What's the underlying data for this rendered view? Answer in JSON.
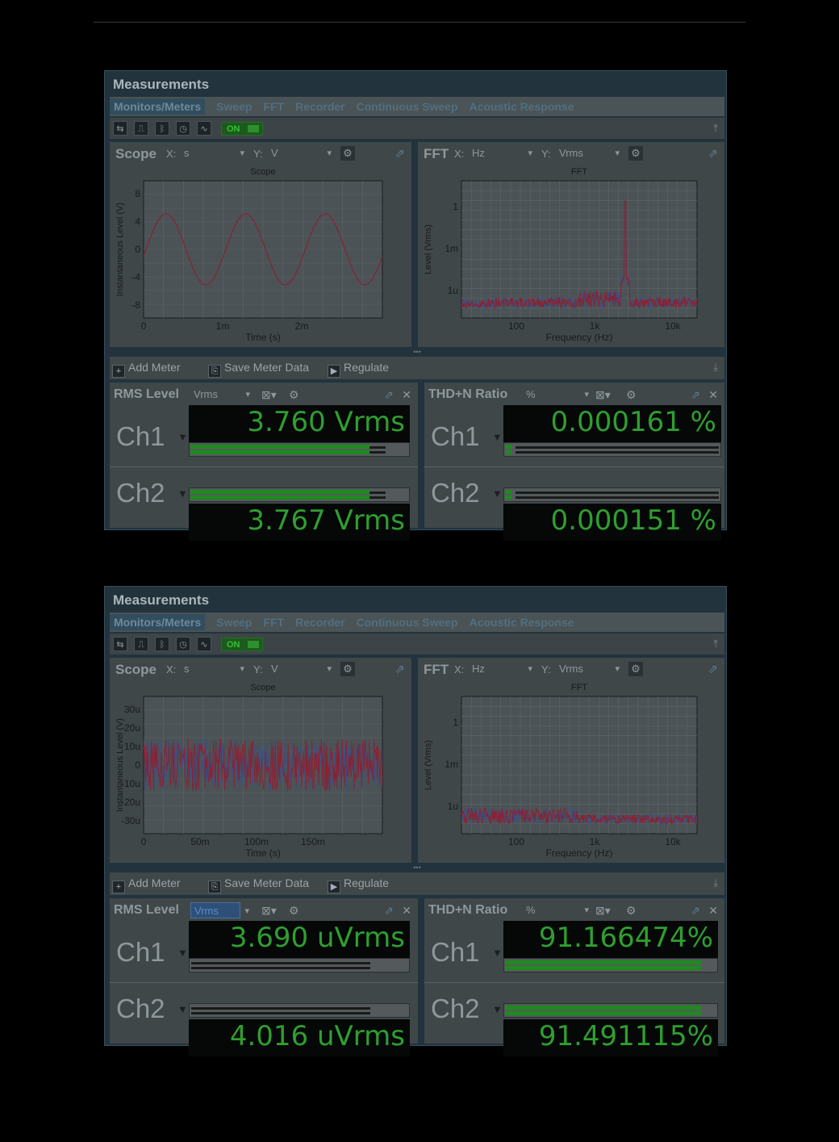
{
  "windows": [
    {
      "title": "Measurements",
      "tabs": [
        "Monitors/Meters",
        "Sweep",
        "FFT",
        "Recorder",
        "Continuous Sweep",
        "Acoustic Response"
      ],
      "on_label": "ON",
      "scope": {
        "title": "Scope",
        "x_label": "X:",
        "x_unit": "s",
        "y_label": "Y:",
        "y_unit": "V",
        "plot_title": "Scope",
        "ylabel": "Instantaneous Level (V)",
        "xlabel": "Time (s)",
        "yticks": [
          "8",
          "4",
          "0",
          "-4",
          "-8"
        ],
        "xticks": [
          "0",
          "1m",
          "2m"
        ]
      },
      "fft": {
        "title": "FFT",
        "x_label": "X:",
        "x_unit": "Hz",
        "y_label": "Y:",
        "y_unit": "Vrms",
        "plot_title": "FFT",
        "ylabel": "Level (Vrms)",
        "xlabel": "Frequency (Hz)",
        "yticks": [
          "1",
          "1m",
          "1u"
        ],
        "xticks": [
          "100",
          "1k",
          "10k"
        ]
      },
      "meterbar": {
        "add": "Add Meter",
        "save": "Save Meter Data",
        "regulate": "Regulate"
      },
      "rms": {
        "title": "RMS Level",
        "unit": "Vrms",
        "ch1_label": "Ch1",
        "ch2_label": "Ch2",
        "ch1_value": "3.760  Vrms",
        "ch2_value": "3.767  Vrms",
        "ch1_level": 0.89,
        "ch2_level": 0.89
      },
      "thd": {
        "title": "THD+N Ratio",
        "unit": "%",
        "ch1_label": "Ch1",
        "ch2_label": "Ch2",
        "ch1_value": "0.000161 %",
        "ch2_value": "0.000151 %",
        "ch1_level": 0.03,
        "ch2_level": 0.03
      }
    },
    {
      "title": "Measurements",
      "tabs": [
        "Monitors/Meters",
        "Sweep",
        "FFT",
        "Recorder",
        "Continuous Sweep",
        "Acoustic Response"
      ],
      "on_label": "ON",
      "scope": {
        "title": "Scope",
        "x_label": "X:",
        "x_unit": "s",
        "y_label": "Y:",
        "y_unit": "V",
        "plot_title": "Scope",
        "ylabel": "Instantaneous Level (V)",
        "xlabel": "Time (s)",
        "yticks": [
          "30u",
          "20u",
          "10u",
          "0",
          "-10u",
          "-20u",
          "-30u"
        ],
        "xticks": [
          "0",
          "50m",
          "100m",
          "150m"
        ]
      },
      "fft": {
        "title": "FFT",
        "x_label": "X:",
        "x_unit": "Hz",
        "y_label": "Y:",
        "y_unit": "Vrms",
        "plot_title": "FFT",
        "ylabel": "Level (Vrms)",
        "xlabel": "Frequency (Hz)",
        "yticks": [
          "1",
          "1m",
          "1u"
        ],
        "xticks": [
          "100",
          "1k",
          "10k"
        ]
      },
      "meterbar": {
        "add": "Add Meter",
        "save": "Save Meter Data",
        "regulate": "Regulate"
      },
      "rms": {
        "title": "RMS Level",
        "unit": "Vrms",
        "ch1_label": "Ch1",
        "ch2_label": "Ch2",
        "ch1_value": "3.690 uVrms",
        "ch2_value": "4.016 uVrms",
        "ch1_level": 0.0,
        "ch2_level": 0.0
      },
      "thd": {
        "title": "THD+N Ratio",
        "unit": "%",
        "ch1_label": "Ch1",
        "ch2_label": "Ch2",
        "ch1_value": "91.166474%",
        "ch2_value": "91.491115%",
        "ch1_level": 1.0,
        "ch2_level": 1.0
      }
    }
  ],
  "colors": {
    "trace_ch1": "#8a2232",
    "trace_ch2": "#3a4f86",
    "meter_green": "#2f9f2f"
  }
}
